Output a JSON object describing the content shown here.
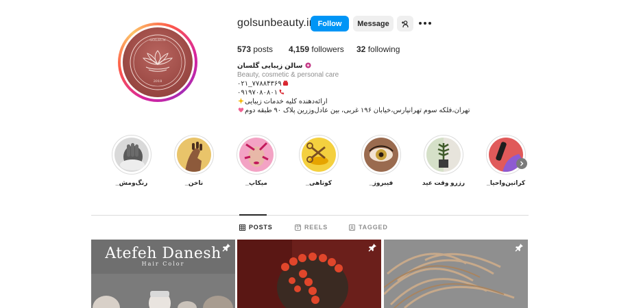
{
  "profile": {
    "username": "golsunbeauty.ir",
    "follow_label": "Follow",
    "message_label": "Message",
    "avatar_logo_text": "GOLSUN",
    "avatar_year": "2018"
  },
  "stats": {
    "posts_count": "573",
    "posts_label": "posts",
    "followers_count": "4,159",
    "followers_label": "followers",
    "following_count": "32",
    "following_label": "following"
  },
  "bio": {
    "name": "سالن زیبایی گلسان",
    "category": "Beauty, cosmetic & personal care",
    "phone1": "۰۲۱_۷۷۸۸۴۳۶۹",
    "phone2": "۰۹۱۹۷۰۸۰۸۰۱",
    "service": "ارائه‌دهنده کلیه خدمات زیبایی",
    "address": "تهران،فلکه سوم تهرانپارس،خیابان ۱۹۶ غربی، بین عادل‌وزرین پلاک ۹۰ طبقه دوم"
  },
  "highlights": [
    {
      "label": "_رنگ‌ومش",
      "icon": "hand-glove"
    },
    {
      "label": "_ناخن",
      "icon": "nail-polish"
    },
    {
      "label": "_میکاپ",
      "icon": "makeup-face"
    },
    {
      "label": "_کوتاهی",
      "icon": "scissors"
    },
    {
      "label": "_فیبروز",
      "icon": "eye"
    },
    {
      "label": "رزرو وقت عید",
      "icon": "plant"
    },
    {
      "label": "_کراتین‌واحیا",
      "icon": "hair-brush"
    }
  ],
  "tabs": [
    {
      "label": "POSTS",
      "icon": "grid-icon",
      "active": true
    },
    {
      "label": "REELS",
      "icon": "reels-icon",
      "active": false
    },
    {
      "label": "TAGGED",
      "icon": "tagged-icon",
      "active": false
    }
  ],
  "posts": [
    {
      "title": "Atefeh Danesh",
      "subtitle": "Hair Color",
      "pinned": true
    },
    {
      "title": "",
      "subtitle": "",
      "pinned": true
    },
    {
      "title": "",
      "subtitle": "",
      "pinned": true
    }
  ],
  "colors": {
    "follow_button": "#0095f6",
    "secondary_button": "#efefef",
    "text": "#262626",
    "muted": "#8e8e8e",
    "avatar_brand": "#9c4a45"
  }
}
